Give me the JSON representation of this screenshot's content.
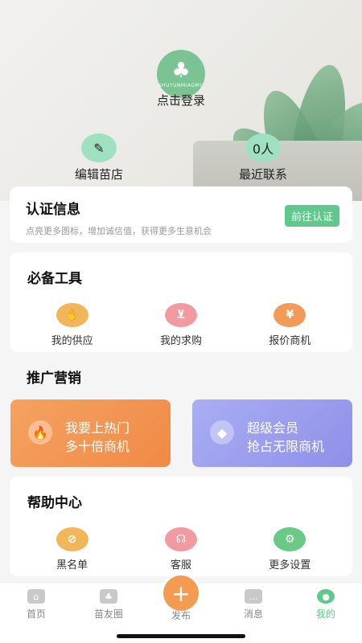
{
  "header": {
    "logo_text": "SHUYUNMIAOMU",
    "login": "点击登录",
    "edit_shop": "编辑苗店",
    "recent_contacts_count": "0人",
    "recent_contacts": "最近联系"
  },
  "auth": {
    "title": "认证信息",
    "subtitle": "点亮更多图标，增加诚信值，获得更多生意机会",
    "button": "前往认证"
  },
  "tools": {
    "title": "必备工具",
    "items": [
      {
        "label": "我的供应",
        "icon": "hand-supply-icon",
        "color": "#f1b65a"
      },
      {
        "label": "我的求购",
        "icon": "cart-icon",
        "color": "#f29aa2"
      },
      {
        "label": "报价商机",
        "icon": "money-bag-icon",
        "color": "#f29b56"
      }
    ]
  },
  "promo": {
    "title": "推广营销",
    "hot": {
      "line1": "我要上热门",
      "line2": "多十倍商机"
    },
    "vip": {
      "line1": "超级会员",
      "line2": "抢占无限商机"
    }
  },
  "help": {
    "title": "帮助中心",
    "items": [
      {
        "label": "黑名单",
        "icon": "blocked-user-icon",
        "color": "#f1b65a"
      },
      {
        "label": "客服",
        "icon": "headset-icon",
        "color": "#f29aa2"
      },
      {
        "label": "更多设置",
        "icon": "gear-icon",
        "color": "#69c985"
      }
    ]
  },
  "tabbar": {
    "home": "首页",
    "friends": "苗友圈",
    "publish": "发布",
    "messages": "消息",
    "mine": "我的"
  },
  "colors": {
    "accent": "#5ec98b",
    "orange": "#f39b51",
    "vip": "#9a9cf0"
  }
}
